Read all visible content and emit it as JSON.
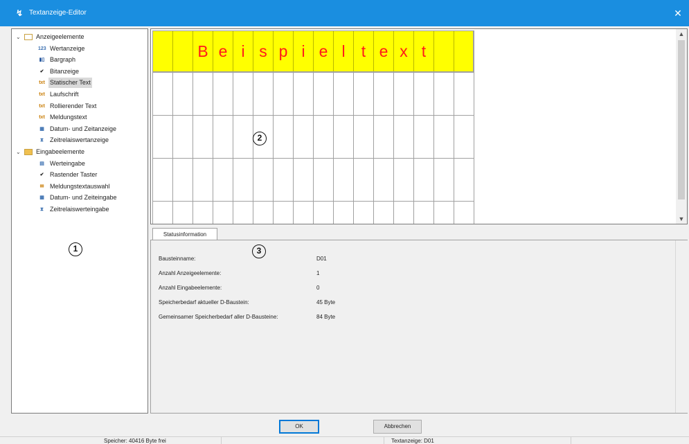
{
  "window": {
    "title": "Textanzeige-Editor",
    "close_glyph": "✕"
  },
  "tree": {
    "groups": [
      {
        "label": "Anzeigeelemente",
        "expanded": true,
        "items": [
          {
            "label": "Wertanzeige",
            "icon": "value-display-icon",
            "glyph": "123",
            "color": "#3a6fb0"
          },
          {
            "label": "Bargraph",
            "icon": "bargraph-icon",
            "glyph": "▮▯",
            "color": "#2a5aa0"
          },
          {
            "label": "Bitanzeige",
            "icon": "checkmark-icon",
            "glyph": "✔",
            "color": "#222222"
          },
          {
            "label": "Statischer Text",
            "icon": "static-text-icon",
            "glyph": "txt",
            "color": "#c87a00",
            "selected": true
          },
          {
            "label": "Laufschrift",
            "icon": "ticker-icon",
            "glyph": "txt",
            "color": "#c87a00"
          },
          {
            "label": "Rollierender Text",
            "icon": "rolling-text-icon",
            "glyph": "txt",
            "color": "#c87a00"
          },
          {
            "label": "Meldungstext",
            "icon": "message-text-icon",
            "glyph": "txt",
            "color": "#c87a00"
          },
          {
            "label": "Datum- und Zeitanzeige",
            "icon": "date-time-icon",
            "glyph": "▦",
            "color": "#3a6fb0"
          },
          {
            "label": "Zeitrelaiswertanzeige",
            "icon": "timer-relay-icon",
            "glyph": "⧗",
            "color": "#3a6fb0"
          }
        ]
      },
      {
        "label": "Eingabeelemente",
        "expanded": true,
        "items": [
          {
            "label": "Werteingabe",
            "icon": "value-input-icon",
            "glyph": "▤",
            "color": "#3a6fb0"
          },
          {
            "label": "Rastender Taster",
            "icon": "latching-button-icon",
            "glyph": "✔",
            "color": "#222222"
          },
          {
            "label": "Meldungstextauswahl",
            "icon": "message-select-icon",
            "glyph": "✉",
            "color": "#c87a00"
          },
          {
            "label": "Datum- und Zeiteingabe",
            "icon": "date-time-input-icon",
            "glyph": "▦",
            "color": "#3a6fb0"
          },
          {
            "label": "Zeitrelaiswerteingabe",
            "icon": "timer-relay-input-icon",
            "glyph": "⧗",
            "color": "#3a6fb0"
          }
        ]
      }
    ]
  },
  "markers": {
    "one": "1",
    "two": "2",
    "three": "3"
  },
  "canvas": {
    "text_chars": [
      "B",
      "e",
      "i",
      "s",
      "p",
      "i",
      "e",
      "l",
      "t",
      "e",
      "x",
      "t"
    ],
    "highlight_color": "#ffff00",
    "text_color": "#ff1a1a"
  },
  "status": {
    "tab_label": "Statusinformation",
    "rows": [
      {
        "label": "Bausteinname:",
        "value": "D01"
      },
      {
        "label": "Anzahl Anzeigeelemente:",
        "value": "1"
      },
      {
        "label": "Anzahl Eingabeelemente:",
        "value": "0"
      },
      {
        "label": "Speicherbedarf aktueller D-Baustein:",
        "value": "45 Byte"
      },
      {
        "label": "Gemeinsamer Speicherbedarf aller D-Bausteine:",
        "value": "84 Byte"
      }
    ]
  },
  "buttons": {
    "ok": "OK",
    "cancel": "Abbrechen"
  },
  "statusbar": {
    "memory": "Speicher: 40416 Byte frei",
    "display": "Textanzeige: D01"
  },
  "colors": {
    "titlebar": "#1a8ee0",
    "accent": "#0078d7"
  }
}
